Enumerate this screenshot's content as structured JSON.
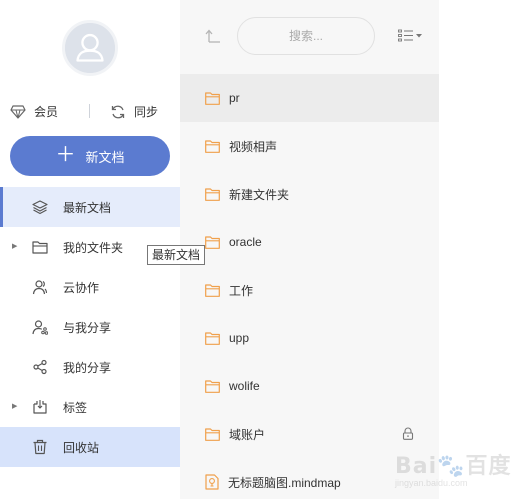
{
  "sidebar": {
    "vip_label": "会员",
    "sync_label": "同步",
    "new_doc_label": "新文档",
    "items": [
      {
        "label": "最新文档",
        "icon": "layers-icon",
        "state": "active"
      },
      {
        "label": "我的文件夹",
        "icon": "folder-outline-icon",
        "expandable": true
      },
      {
        "label": "云协作",
        "icon": "users-icon"
      },
      {
        "label": "与我分享",
        "icon": "user-share-icon"
      },
      {
        "label": "我的分享",
        "icon": "share-icon"
      },
      {
        "label": "标签",
        "icon": "tag-icon",
        "expandable": true
      },
      {
        "label": "回收站",
        "icon": "trash-icon",
        "state": "selected"
      }
    ]
  },
  "tooltip": {
    "text": "最新文档"
  },
  "toolbar": {
    "search_placeholder": "搜索..."
  },
  "files": [
    {
      "name": "pr",
      "type": "folder"
    },
    {
      "name": "视频相声",
      "type": "folder"
    },
    {
      "name": "新建文件夹",
      "type": "folder"
    },
    {
      "name": "oracle",
      "type": "folder"
    },
    {
      "name": "工作",
      "type": "folder"
    },
    {
      "name": "upp",
      "type": "folder"
    },
    {
      "name": "wolife",
      "type": "folder"
    },
    {
      "name": "域账户",
      "type": "folder",
      "locked": true
    },
    {
      "name": "无标题脑图.mindmap",
      "type": "mindmap"
    }
  ],
  "colors": {
    "accent": "#5b7bd0",
    "folder": "#f0a04b",
    "active_bg": "#e5ecfb"
  }
}
